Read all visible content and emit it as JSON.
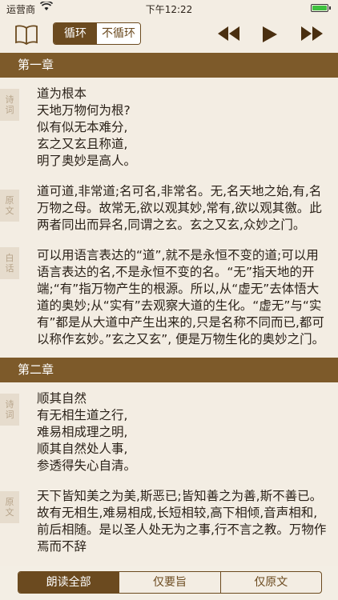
{
  "status": {
    "carrier": "运营商",
    "time": "下午12:22"
  },
  "toolbar": {
    "mode_loop": "循环",
    "mode_noloop": "不循环"
  },
  "chapters": [
    {
      "title": "第一章",
      "sections": [
        {
          "tag": [
            "诗",
            "词"
          ],
          "text": "道为根本\n天地万物何为根?\n似有似无本难分,\n玄之又玄且称道,\n明了奥妙是高人。"
        },
        {
          "tag": [
            "原",
            "文"
          ],
          "text": "道可道,非常道;名可名,非常名。无,名天地之始,有,名万物之母。故常无,欲以观其妙,常有,欲以观其徼。此两者同出而异名,同谓之玄。玄之又玄,众妙之门。"
        },
        {
          "tag": [
            "白",
            "话"
          ],
          "text": "可以用语言表达的“道”,就不是永恒不变的道;可以用语言表达的名,不是永恒不变的名。“无”指天地的开端;“有”指万物产生的根源。所以,从“虚无”去体悟大道的奥妙;从“实有”去观察大道的生化。“虚无”与“实有”都是从大道中产生出来的,只是名称不同而已,都可以称作玄妙。”玄之又玄”, 便是万物生化的奥妙之门。"
        }
      ]
    },
    {
      "title": "第二章",
      "sections": [
        {
          "tag": [
            "诗",
            "词"
          ],
          "text": "顺其自然\n有无相生道之行,\n难易相成理之明,\n顺其自然处人事,\n参透得失心自清。"
        },
        {
          "tag": [
            "原",
            "文"
          ],
          "text": "天下皆知美之为美,斯恶已;皆知善之为善,斯不善已。故有无相生,难易相成,长短相较,高下相倾,音声相和,前后相随。是以圣人处无为之事,行不言之教。万物作焉而不辞"
        }
      ]
    }
  ],
  "bottombar": {
    "read_all": "朗读全部",
    "only_key": "仅要旨",
    "only_original": "仅原文"
  },
  "colors": {
    "accent": "#7d5a2a",
    "background": "#f3ede3"
  }
}
